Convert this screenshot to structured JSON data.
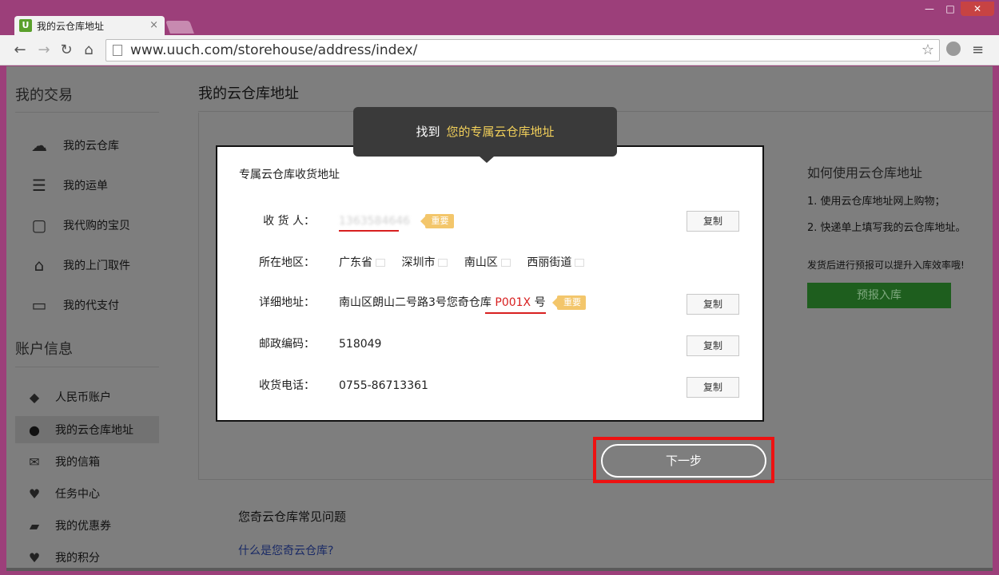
{
  "browser": {
    "tab_title": "我的云仓库地址",
    "tab_logo": "U",
    "tab_close": "×",
    "url": "www.uuch.com/storehouse/address/index/",
    "window_controls": {
      "minimize": "—",
      "maximize": "□",
      "close": "✕"
    },
    "nav_icons": {
      "back": "←",
      "forward": "→",
      "reload": "↻",
      "home": "⌂"
    }
  },
  "sidebar": {
    "section1_title": "我的交易",
    "section1_items": [
      {
        "label": "我的云仓库",
        "icon": "cloud-icon"
      },
      {
        "label": "我的运单",
        "icon": "waybill-icon"
      },
      {
        "label": "我代购的宝贝",
        "icon": "shopping-bag-icon"
      },
      {
        "label": "我的上门取件",
        "icon": "house-icon"
      },
      {
        "label": "我的代支付",
        "icon": "card-icon"
      }
    ],
    "section2_title": "账户信息",
    "section2_items": [
      {
        "label": "人民币账户",
        "icon": "yuan-icon"
      },
      {
        "label": "我的云仓库地址",
        "icon": "location-pin-icon",
        "active": true
      },
      {
        "label": "我的信箱",
        "icon": "mail-icon"
      },
      {
        "label": "任务中心",
        "icon": "heart-icon"
      },
      {
        "label": "我的优惠券",
        "icon": "coupon-icon"
      },
      {
        "label": "我的积分",
        "icon": "heart-icon"
      }
    ]
  },
  "main": {
    "page_title": "我的云仓库地址",
    "right": {
      "title": "如何使用云仓库地址",
      "step1": "1. 使用云仓库地址网上购物；",
      "step2": "2. 快递单上填写我的云仓库地址。",
      "note": "发货后进行预报可以提升入库效率哦!",
      "prereport_button": "预报入库"
    },
    "faq_title": "您奇云仓库常见问题",
    "faq_link": "什么是您奇云仓库?"
  },
  "tooltip": {
    "prefix": "找到",
    "highlight": "您的专属云仓库地址"
  },
  "address_card": {
    "title": "专属云仓库收货地址",
    "important_badge": "重要",
    "copy_label": "复制",
    "recipient": {
      "label": "收 货 人：",
      "value": "1363584646"
    },
    "region": {
      "label": "所在地区：",
      "values": [
        "广东省",
        "深圳市",
        "南山区",
        "西丽街道"
      ]
    },
    "detail": {
      "label": "详细地址：",
      "prefix": "南山区朗山二号路3号您奇仓库",
      "code": "P001X",
      "suffix": "号"
    },
    "postcode": {
      "label": "邮政编码：",
      "value": "518049"
    },
    "phone": {
      "label": "收货电话：",
      "value": "0755-86713361"
    }
  },
  "next_button": "下一步",
  "colors": {
    "accent_red": "#ee1111",
    "badge": "#f3c66b",
    "tooltip_highlight": "#f2d05a",
    "prereport": "#1e5e1e"
  }
}
